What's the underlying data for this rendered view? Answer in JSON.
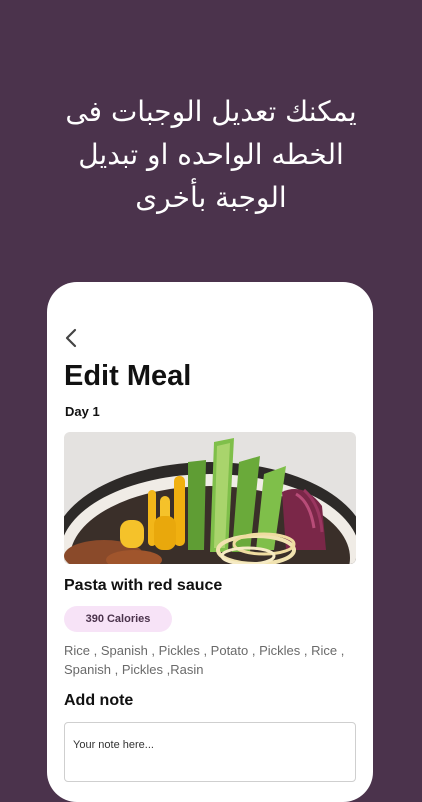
{
  "promo": {
    "line1": "يمكنك تعديل الوجبات فى",
    "line2": "الخطه الواحده او تبديل",
    "line3": "الوجبة بأخرى"
  },
  "screen": {
    "title": "Edit Meal",
    "day_label": "Day 1"
  },
  "meal": {
    "name": "Pasta with red sauce",
    "calories_badge": "390 Calories",
    "ingredients": "Rice , Spanish , Pickles , Potato , Pickles , Rice , Spanish , Pickles ,Rasin",
    "image_description": "bowl of pasta with cucumber, carrots and red cabbage"
  },
  "note": {
    "label": "Add note",
    "placeholder": "Your note here..."
  },
  "colors": {
    "background": "#4b334c",
    "card": "#ffffff",
    "badge_bg": "#f7e3f7",
    "badge_text": "#4b334c"
  },
  "icons": {
    "back": "chevron-left-icon"
  }
}
